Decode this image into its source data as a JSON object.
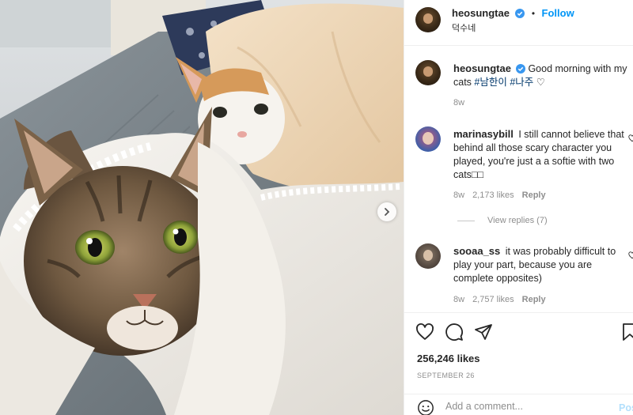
{
  "post": {
    "username": "heosungtae",
    "follow_label": "Follow",
    "separator": "•",
    "location": "덕수네",
    "image_alt": "Two cats wrapped in blankets on a grey sofa"
  },
  "caption": {
    "username": "heosungtae",
    "text": "Good morning with my cats ",
    "hashtags": [
      "#남한이",
      "#나주"
    ],
    "suffix": " ♡",
    "time": "8w"
  },
  "comments": [
    {
      "username": "marinasybill",
      "text": "I still cannot believe that behind all those scary character you played, you're just a a softie with two cats□□",
      "time": "8w",
      "likes": "2,173 likes",
      "reply_label": "Reply",
      "view_replies": "View replies (7)"
    },
    {
      "username": "sooaa_ss",
      "text": "it was probably difficult to play your part, because you are complete opposites)",
      "time": "8w",
      "likes": "2,757 likes",
      "reply_label": "Reply"
    }
  ],
  "footer": {
    "likes": "256,246 likes",
    "date": "SEPTEMBER 26",
    "comment_placeholder": "Add a comment...",
    "post_label": "Post"
  },
  "icons": {
    "like": "heart-icon",
    "comment": "comment-icon",
    "share": "share-icon",
    "save": "bookmark-icon",
    "verified": "verified-badge-icon",
    "next": "chevron-right-icon",
    "emoji": "emoji-icon"
  },
  "colors": {
    "accent": "#0095f6",
    "hashtag": "#00376b",
    "muted": "#8e8e8e"
  }
}
